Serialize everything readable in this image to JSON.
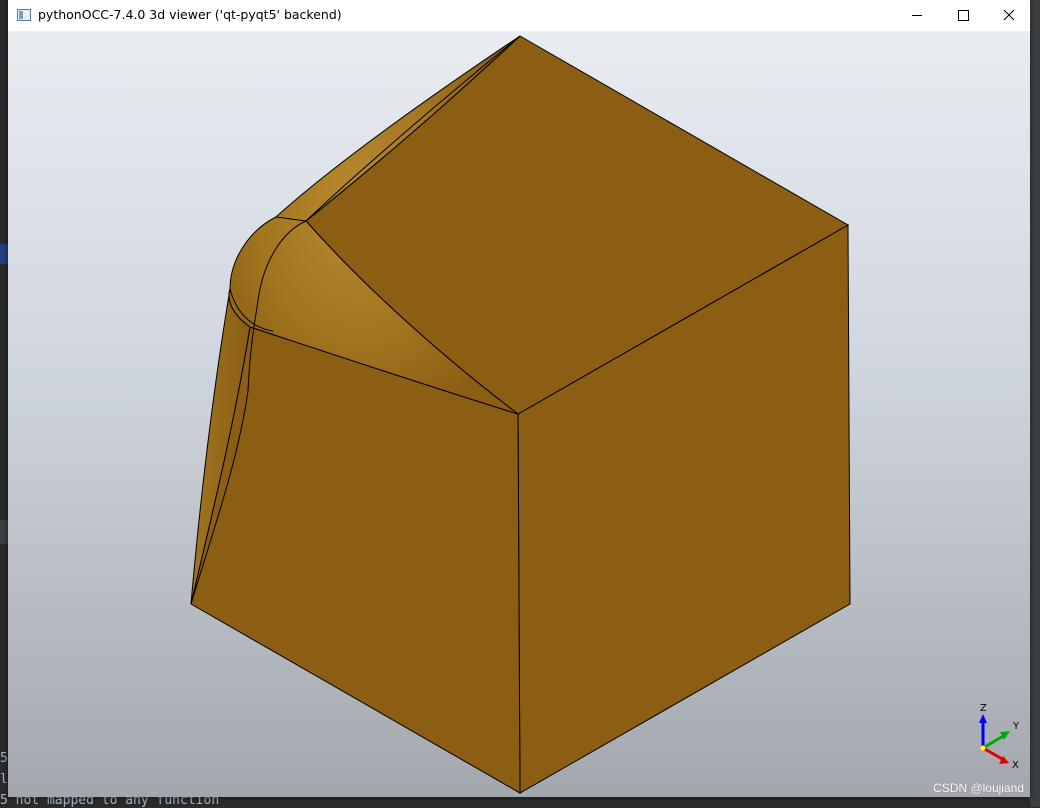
{
  "window": {
    "title": "pythonOCC-7.4.0 3d viewer ('qt-pyqt5' backend)",
    "controls": {
      "minimize": "minimize-icon",
      "maximize": "maximize-icon",
      "close": "close-icon"
    }
  },
  "viewer": {
    "background_top": "#e9ecf1",
    "background_bottom": "#a3a7ad",
    "shape_color": "#8b5e14",
    "shape_highlight": "#b7862e",
    "edge_color": "#000000",
    "triedron": {
      "z_label": "Z",
      "y_label": "Y",
      "x_label": "X",
      "z_color": "#0000ff",
      "y_color": "#00aa00",
      "x_color": "#dd0000"
    },
    "watermark": "CSDN @loujiand"
  },
  "background_console": {
    "line_1": "5",
    "line_2": "ld",
    "line_3": "5 not mapped to any function"
  }
}
